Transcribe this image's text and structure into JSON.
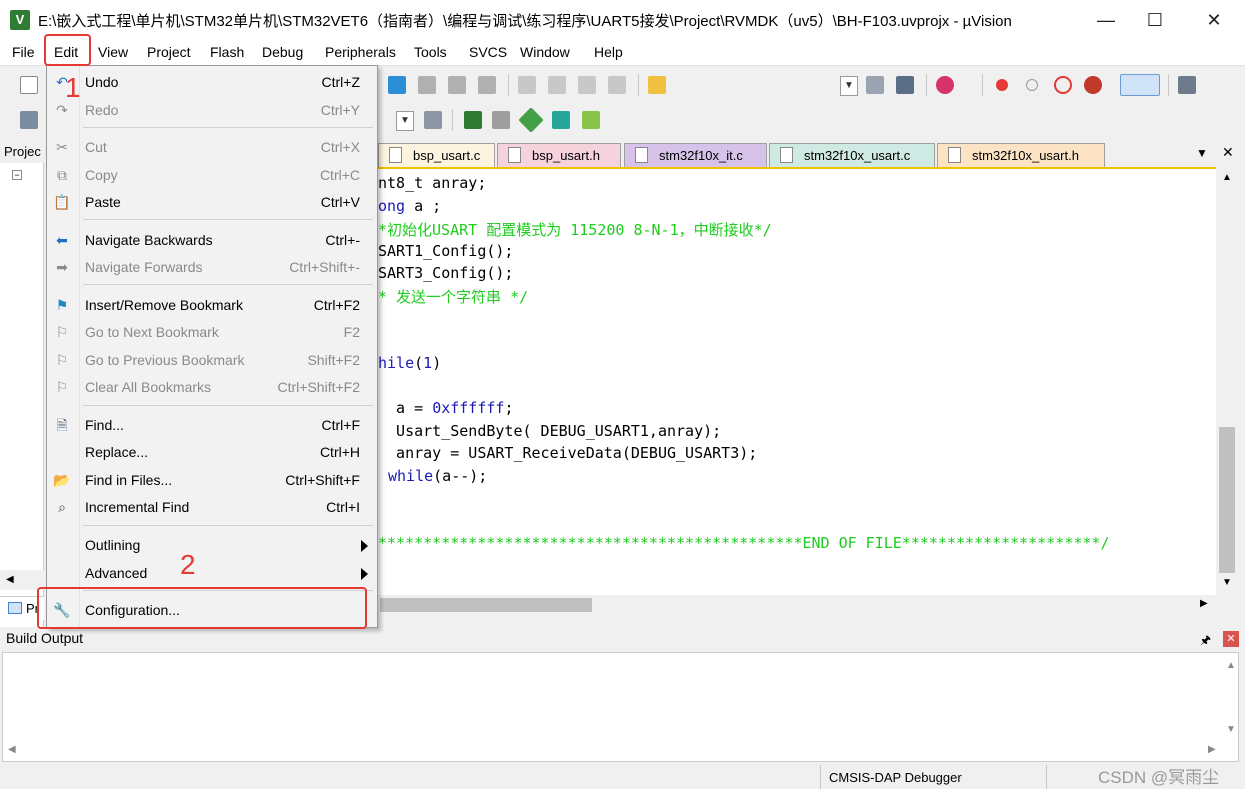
{
  "window": {
    "title": "E:\\嵌入式工程\\单片机\\STM32单片机\\STM32VET6（指南者）\\编程与调试\\练习程序\\UART5接发\\Project\\RVMDK（uv5）\\BH-F103.uvprojx - µVision",
    "icon_label": "V",
    "minimize": "—",
    "maximize": "☐",
    "close": "✕"
  },
  "menubar": [
    "File",
    "Edit",
    "View",
    "Project",
    "Flash",
    "Debug",
    "Peripherals",
    "Tools",
    "SVCS",
    "Window",
    "Help"
  ],
  "project_pane": {
    "title": "Projec",
    "bottom_tab": "Pr"
  },
  "tabs": [
    {
      "label": "bsp_usart.c",
      "color": "#fdf4e0"
    },
    {
      "label": "bsp_usart.h",
      "color": "#f6d3dc"
    },
    {
      "label": "stm32f10x_it.c",
      "color": "#d7c3ea"
    },
    {
      "label": "stm32f10x_usart.c",
      "color": "#cfe9e3"
    },
    {
      "label": "stm32f10x_usart.h",
      "color": "#fbe3c3"
    }
  ],
  "tab_controls": {
    "dropdown": "▼",
    "close": "✕"
  },
  "code": {
    "l1": "nt8_t anray;",
    "l2_kw": "ong",
    "l2_rest": " a ;",
    "l3": "*初始化USART 配置模式为 115200 8-N-1，中断接收*/",
    "l4": "SART1_Config();",
    "l5": "SART3_Config();",
    "l6": "* 发送一个字符串 */",
    "l7_kw": "hile",
    "l7_open": "(",
    "l7_num": "1",
    "l7_close": ")",
    "l8_pre": "  a = ",
    "l8_num": "0xffffff",
    "l8_post": ";",
    "l9": "  Usart_SendByte( DEBUG_USART1,anray);",
    "l10": "  anray = USART_ReceiveData(DEBUG_USART3);",
    "l11_kw": "while",
    "l11_rest": "(a--);",
    "l12": "***********************************************END OF FILE**********************/"
  },
  "edit_menu": {
    "items": [
      {
        "label": "Undo",
        "shortcut": "Ctrl+Z",
        "icon": "undo-icon",
        "enabled": true
      },
      {
        "label": "Redo",
        "shortcut": "Ctrl+Y",
        "icon": "redo-icon",
        "enabled": false
      },
      {
        "label": "Cut",
        "shortcut": "Ctrl+X",
        "icon": "cut-icon",
        "enabled": false
      },
      {
        "label": "Copy",
        "shortcut": "Ctrl+C",
        "icon": "copy-icon",
        "enabled": false
      },
      {
        "label": "Paste",
        "shortcut": "Ctrl+V",
        "icon": "paste-icon",
        "enabled": true
      },
      {
        "label": "Navigate Backwards",
        "shortcut": "Ctrl+-",
        "icon": "arrow-left-icon",
        "enabled": true
      },
      {
        "label": "Navigate Forwards",
        "shortcut": "Ctrl+Shift+-",
        "icon": "arrow-right-icon",
        "enabled": false
      },
      {
        "label": "Insert/Remove Bookmark",
        "shortcut": "Ctrl+F2",
        "icon": "bookmark-flag-icon",
        "enabled": true
      },
      {
        "label": "Go to Next Bookmark",
        "shortcut": "F2",
        "icon": "bookmark-next-icon",
        "enabled": false
      },
      {
        "label": "Go to Previous Bookmark",
        "shortcut": "Shift+F2",
        "icon": "bookmark-prev-icon",
        "enabled": false
      },
      {
        "label": "Clear All Bookmarks",
        "shortcut": "Ctrl+Shift+F2",
        "icon": "bookmark-clear-icon",
        "enabled": false
      },
      {
        "label": "Find...",
        "shortcut": "Ctrl+F",
        "icon": "find-icon",
        "enabled": true
      },
      {
        "label": "Replace...",
        "shortcut": "Ctrl+H",
        "icon": "",
        "enabled": true
      },
      {
        "label": "Find in Files...",
        "shortcut": "Ctrl+Shift+F",
        "icon": "find-in-files-icon",
        "enabled": true
      },
      {
        "label": "Incremental Find",
        "shortcut": "Ctrl+I",
        "icon": "binoculars-icon",
        "enabled": true
      },
      {
        "label": "Outlining",
        "shortcut": "",
        "icon": "",
        "enabled": true
      },
      {
        "label": "Advanced",
        "shortcut": "",
        "icon": "",
        "enabled": true
      },
      {
        "label": "Configuration...",
        "shortcut": "",
        "icon": "wrench-icon",
        "enabled": true
      }
    ]
  },
  "annotations": {
    "step1": "1",
    "step2": "2",
    "color": "#e53935"
  },
  "build_output": {
    "title": "Build Output",
    "pin": "🖈",
    "close": "✕"
  },
  "status_bar": {
    "debugger": "CMSIS-DAP Debugger",
    "watermark": "CSDN @冥雨尘"
  }
}
